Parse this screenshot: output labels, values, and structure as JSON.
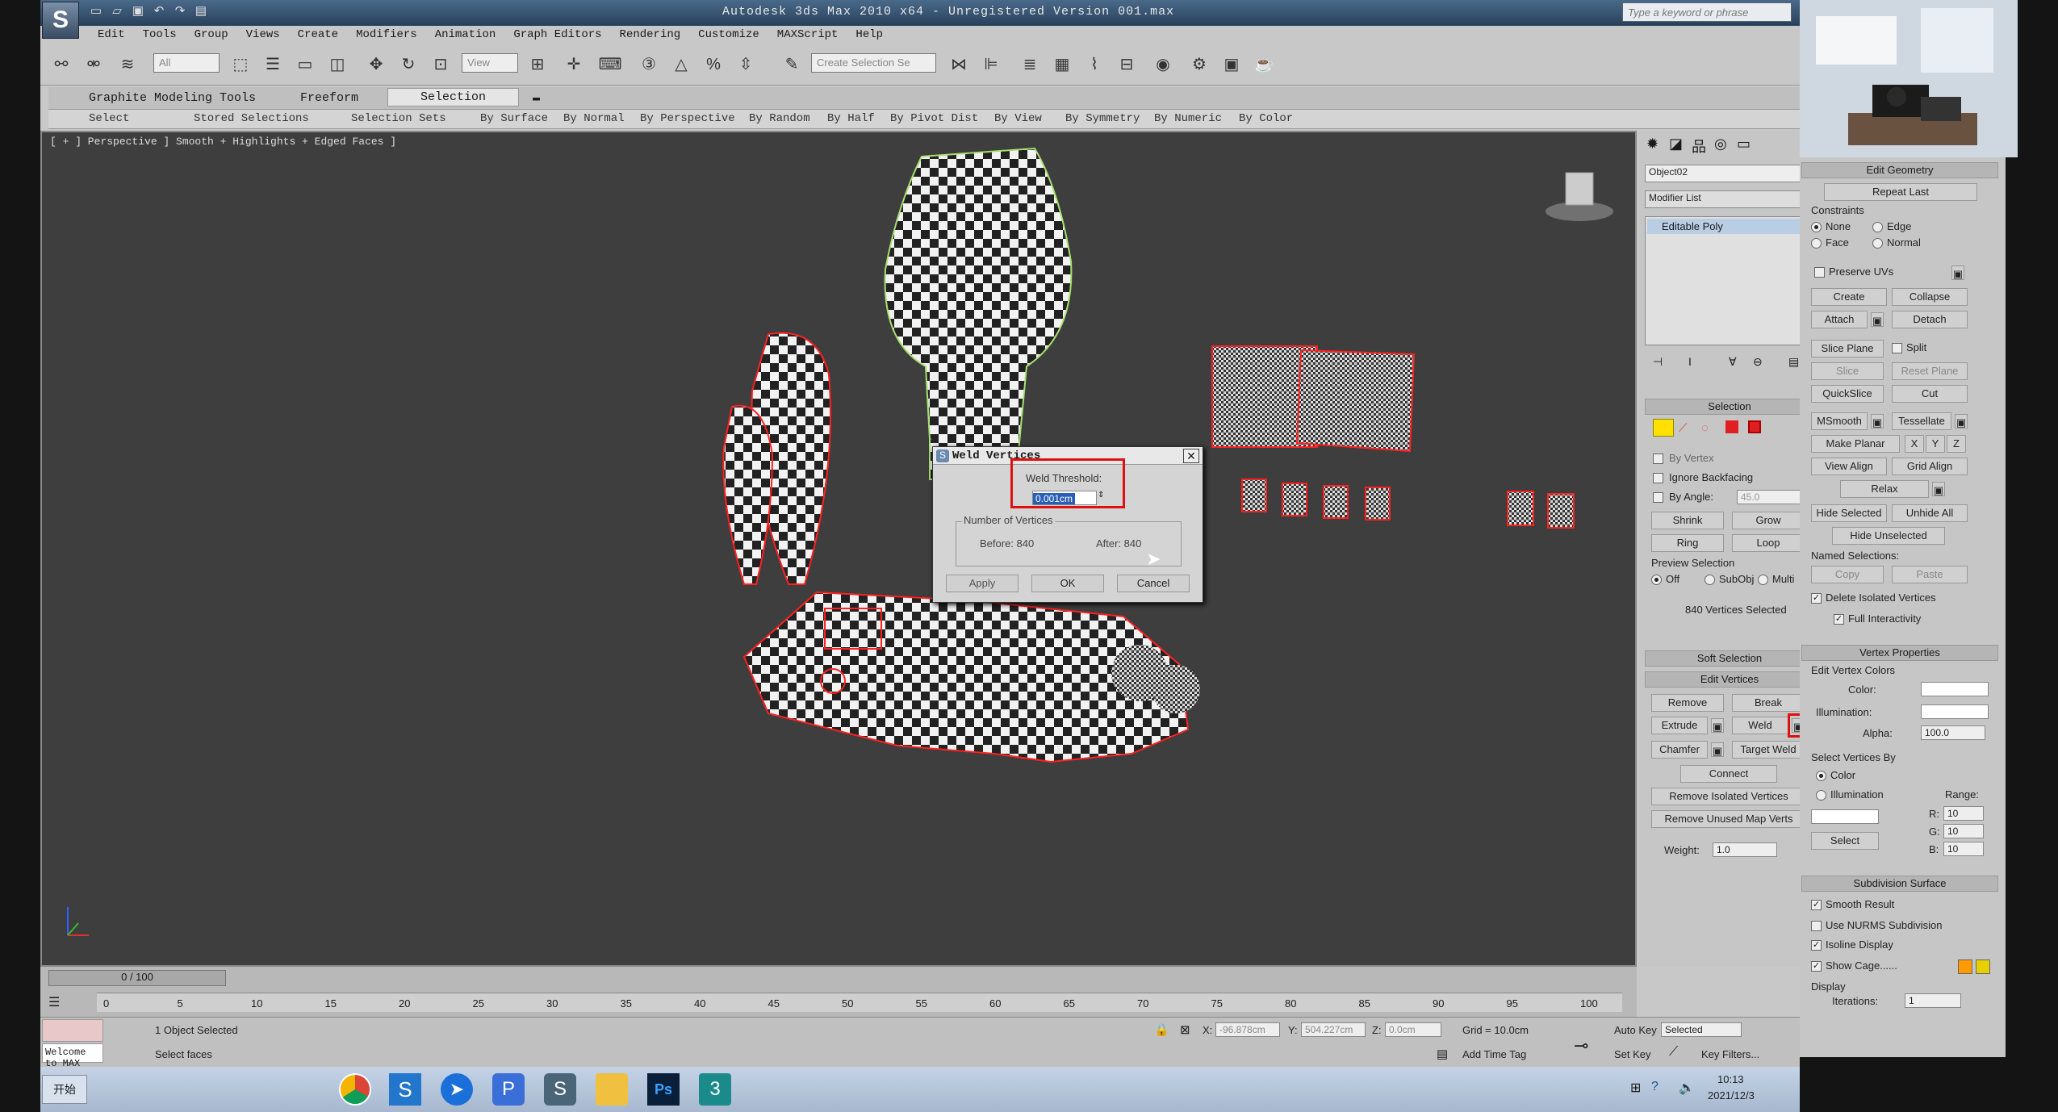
{
  "window": {
    "title": "Autodesk 3ds Max  2010 x64  - Unregistered Version  001.max",
    "search_placeholder": "Type a keyword or phrase"
  },
  "menu": [
    "Edit",
    "Tools",
    "Group",
    "Views",
    "Create",
    "Modifiers",
    "Animation",
    "Graph Editors",
    "Rendering",
    "Customize",
    "MAXScript",
    "Help"
  ],
  "toolbar": {
    "filter": "All",
    "view_select": "View",
    "selection_set": "Create Selection Se"
  },
  "ribbon": {
    "tabs": [
      "Graphite Modeling Tools",
      "Freeform",
      "Selection"
    ],
    "sub": [
      "Select",
      "Stored Selections",
      "Selection Sets",
      "By Surface",
      "By Normal",
      "By Perspective",
      "By Random",
      "By Half",
      "By Pivot Dist",
      "By View",
      "By Symmetry",
      "By Numeric",
      "By Color"
    ]
  },
  "viewport": {
    "label": "[ + ] Perspective ] Smooth + Highlights + Edged Faces ]"
  },
  "dialog": {
    "title": "Weld Vertices",
    "threshold_label": "Weld Threshold:",
    "threshold_value": "0.001cm",
    "group_label": "Number of Vertices",
    "before": "Before: 840",
    "after": "After: 840",
    "apply": "Apply",
    "ok": "OK",
    "cancel": "Cancel"
  },
  "cmd": {
    "object_name": "Object02",
    "modifier_list": "Modifier List",
    "stack_item": "Editable Poly",
    "selection": {
      "header": "Selection",
      "by_vertex": "By Vertex",
      "ignore_backfacing": "Ignore Backfacing",
      "by_angle": "By Angle:",
      "angle_value": "45.0",
      "shrink": "Shrink",
      "grow": "Grow",
      "ring": "Ring",
      "loop": "Loop",
      "preview_label": "Preview Selection",
      "off": "Off",
      "subobj": "SubObj",
      "multi": "Multi",
      "status": "840 Vertices Selected"
    },
    "soft_selection": "Soft Selection",
    "edit_vertices": {
      "header": "Edit Vertices",
      "remove": "Remove",
      "break": "Break",
      "extrude": "Extrude",
      "weld": "Weld",
      "chamfer": "Chamfer",
      "target_weld": "Target Weld",
      "connect": "Connect",
      "remove_isolated": "Remove Isolated Vertices",
      "remove_unused": "Remove Unused Map Verts",
      "weight_label": "Weight:",
      "weight_value": "1.0"
    }
  },
  "right": {
    "edit_geometry": "Edit Geometry",
    "repeat_last": "Repeat Last",
    "constraints": "Constraints",
    "none": "None",
    "edge": "Edge",
    "face": "Face",
    "normal": "Normal",
    "preserve_uvs": "Preserve UVs",
    "create": "Create",
    "collapse": "Collapse",
    "attach": "Attach",
    "detach": "Detach",
    "slice_plane": "Slice Plane",
    "split": "Split",
    "slice": "Slice",
    "reset_plane": "Reset Plane",
    "quickslice": "QuickSlice",
    "cut": "Cut",
    "msmooth": "MSmooth",
    "tessellate": "Tessellate",
    "make_planar": "Make Planar",
    "x": "X",
    "y": "Y",
    "z": "Z",
    "view_align": "View Align",
    "grid_align": "Grid Align",
    "relax": "Relax",
    "hide_selected": "Hide Selected",
    "unhide_all": "Unhide All",
    "hide_unselected": "Hide Unselected",
    "named_selections": "Named Selections:",
    "copy": "Copy",
    "paste": "Paste",
    "delete_isolated": "Delete Isolated Vertices",
    "full_interactivity": "Full Interactivity",
    "vertex_properties": "Vertex Properties",
    "edit_vertex_colors": "Edit Vertex Colors",
    "color": "Color:",
    "illumination": "Illumination:",
    "alpha": "Alpha:",
    "alpha_value": "100.0",
    "select_vertices_by": "Select Vertices By",
    "sv_color": "Color",
    "sv_illumination": "Illumination",
    "range": "Range:",
    "r": "R:",
    "g": "G:",
    "b": "B:",
    "rv": "10",
    "gv": "10",
    "bv": "10",
    "select": "Select",
    "subdivision_surface": "Subdivision Surface",
    "smooth_result": "Smooth Result",
    "use_nurms": "Use NURMS Subdivision",
    "isoline_display": "Isoline Display",
    "show_cage": "Show Cage......",
    "display": "Display",
    "iterations": "Iterations:",
    "iterations_value": "1"
  },
  "timeline": {
    "frame": "0 / 100",
    "ticks": [
      "0",
      "5",
      "10",
      "15",
      "20",
      "25",
      "30",
      "35",
      "40",
      "45",
      "50",
      "55",
      "60",
      "65",
      "70",
      "75",
      "80",
      "85",
      "90",
      "95",
      "100"
    ]
  },
  "status": {
    "objects": "1 Object Selected",
    "prompt": "Select faces",
    "welcome": "Welcome to MAX",
    "x_label": "X:",
    "x": "-96.878cm",
    "y_label": "Y:",
    "y": "504.227cm",
    "z_label": "Z:",
    "z": "0.0cm",
    "grid": "Grid = 10.0cm",
    "auto_key": "Auto Key",
    "set_key": "Set Key",
    "selected": "Selected",
    "key_filters": "Key Filters...",
    "add_time_tag": "Add Time Tag",
    "frame_value": "0"
  },
  "taskbar": {
    "start": "开始",
    "time": "10:13",
    "date": "2021/12/3"
  },
  "colors": {
    "wire_red": "#ff2020",
    "viewport_bg": "#3e3e3e",
    "highlight": "#e01010"
  }
}
